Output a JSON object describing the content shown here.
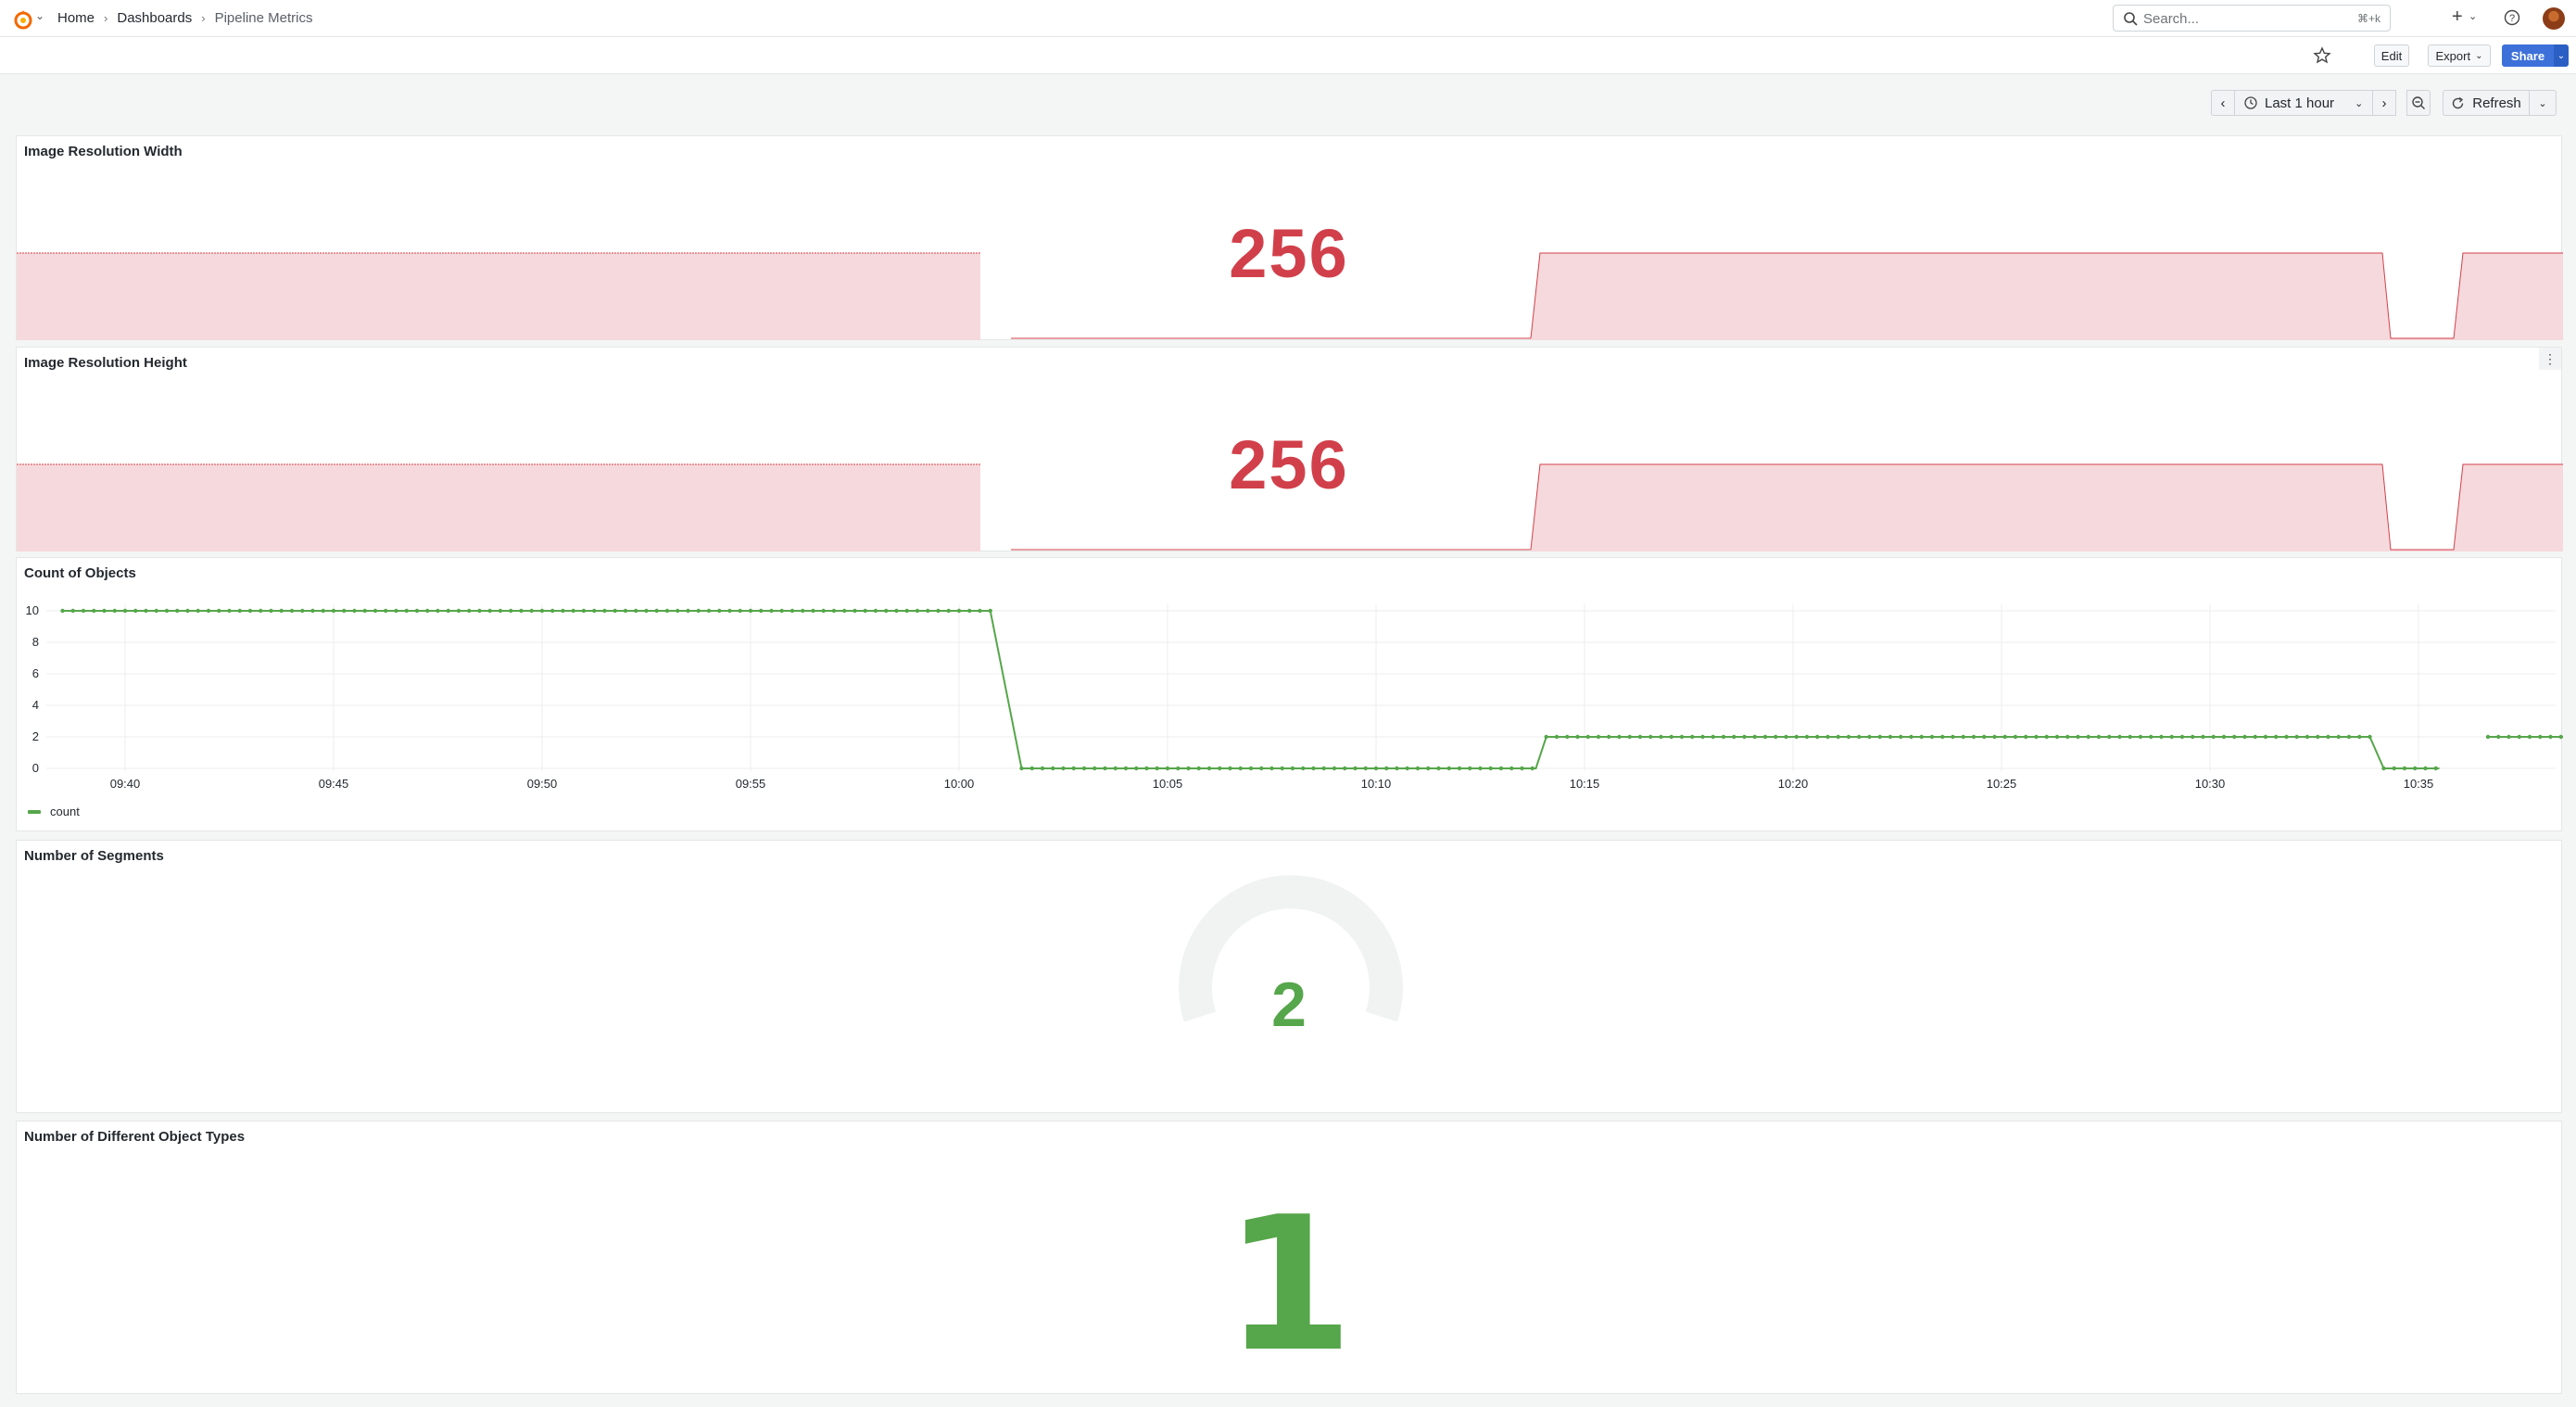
{
  "breadcrumb": {
    "home": "Home",
    "dashboards": "Dashboards",
    "current": "Pipeline Metrics"
  },
  "search": {
    "placeholder": "Search...",
    "shortcut": "⌘+k"
  },
  "toolbar": {
    "edit": "Edit",
    "export": "Export",
    "share": "Share"
  },
  "time": {
    "range": "Last 1 hour",
    "refresh": "Refresh"
  },
  "colors": {
    "red": "#d1404a",
    "red_fill": "#f6d9dc",
    "green": "#56a64b",
    "accent": "#3d71d9"
  },
  "panels": [
    {
      "title": "Image Resolution Width",
      "value": "256"
    },
    {
      "title": "Image Resolution Height",
      "value": "256"
    },
    {
      "title": "Count of Objects"
    },
    {
      "title": "Number of Segments",
      "value": "2"
    },
    {
      "title": "Number of Different Object Types",
      "value": "1"
    }
  ],
  "chart_data": {
    "type": "line",
    "title": "Count of Objects",
    "x_ticks": [
      "09:40",
      "09:45",
      "09:50",
      "09:55",
      "10:00",
      "10:05",
      "10:10",
      "10:15",
      "10:20",
      "10:25",
      "10:30",
      "10:35"
    ],
    "y_ticks": [
      "0",
      "2",
      "4",
      "6",
      "8",
      "10"
    ],
    "ylim": [
      0,
      10
    ],
    "grid": true,
    "legend": "bottom-left",
    "series": [
      {
        "name": "count",
        "segments": [
          {
            "from": "09:38:30",
            "to": "10:00:45",
            "value": 10
          },
          {
            "from": "10:01:30",
            "to": "10:13:50",
            "value": 0
          },
          {
            "from": "10:14:05",
            "to": "10:33:50",
            "value": 2
          },
          {
            "from": "10:34:10",
            "to": "10:35:30",
            "value": 0
          },
          {
            "from": "10:36:40",
            "to": "10:38:30",
            "value": 2
          }
        ]
      }
    ]
  }
}
